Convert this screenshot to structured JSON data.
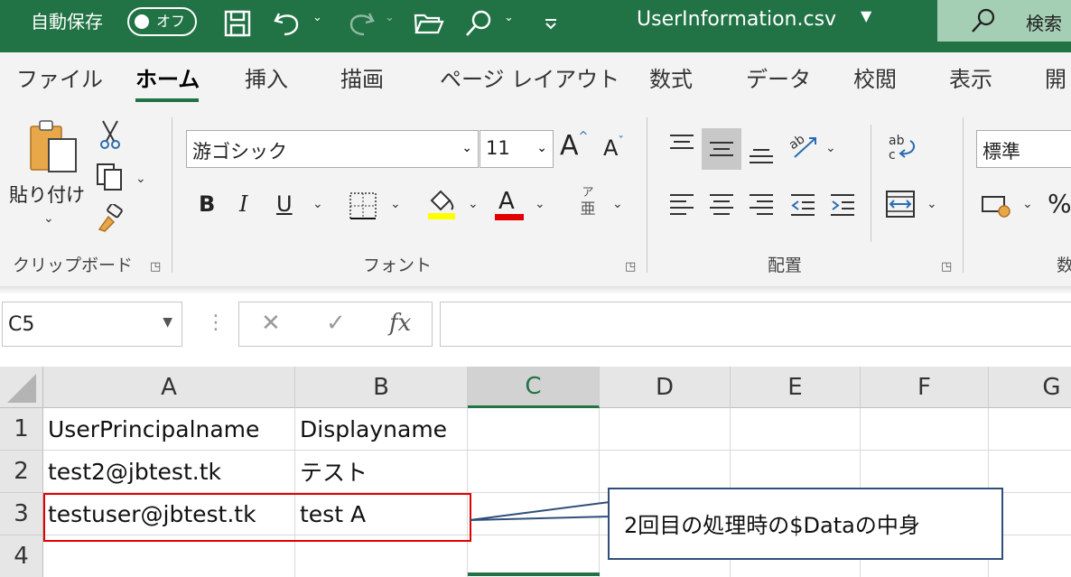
{
  "titlebar": {
    "autosave_label": "自動保存",
    "autosave_state": "オフ",
    "filename": "UserInformation.csv",
    "search_label": "検索",
    "icons": [
      "save-icon",
      "undo-icon",
      "redo-icon",
      "open-folder-icon",
      "search-icon",
      "customize-icon"
    ]
  },
  "tabs": [
    {
      "label": "ファイル"
    },
    {
      "label": "ホーム"
    },
    {
      "label": "挿入"
    },
    {
      "label": "描画"
    },
    {
      "label": "ページ レイアウト"
    },
    {
      "label": "数式"
    },
    {
      "label": "データ"
    },
    {
      "label": "校閲"
    },
    {
      "label": "表示"
    },
    {
      "label": "開"
    }
  ],
  "ribbon": {
    "clipboard": {
      "paste_label": "貼り付け",
      "group_label": "クリップボード"
    },
    "font": {
      "font_name": "游ゴシック",
      "font_size": "11",
      "group_label": "フォント",
      "bold": "B",
      "italic": "I",
      "underline": "U",
      "font_color_letter": "A",
      "phonetic_top": "ア",
      "phonetic_bottom": "亜",
      "grow": "A",
      "shrink": "A"
    },
    "alignment": {
      "group_label": "配置"
    },
    "number": {
      "format": "標準",
      "group_label": "数",
      "percent": "%"
    }
  },
  "formula_bar": {
    "name_box": "C5",
    "cancel": "✕",
    "enter": "✓",
    "fx": "fx",
    "content": ""
  },
  "grid": {
    "columns": [
      "A",
      "B",
      "C",
      "D",
      "E",
      "F",
      "G"
    ],
    "selected_column": "C",
    "rows": [
      "1",
      "2",
      "3",
      "4"
    ],
    "cells": [
      [
        "UserPrincipalname",
        "Displayname"
      ],
      [
        "test2@jbtest.tk",
        "テスト"
      ],
      [
        "testuser@jbtest.tk",
        "test A"
      ],
      [
        "",
        ""
      ]
    ]
  },
  "annotation": {
    "callout_text": "2回目の処理時の$Dataの中身",
    "highlight_color": "#e00000"
  },
  "colors": {
    "brand": "#217346",
    "highlight_yellow": "#ffff00",
    "font_red": "#e00000"
  }
}
